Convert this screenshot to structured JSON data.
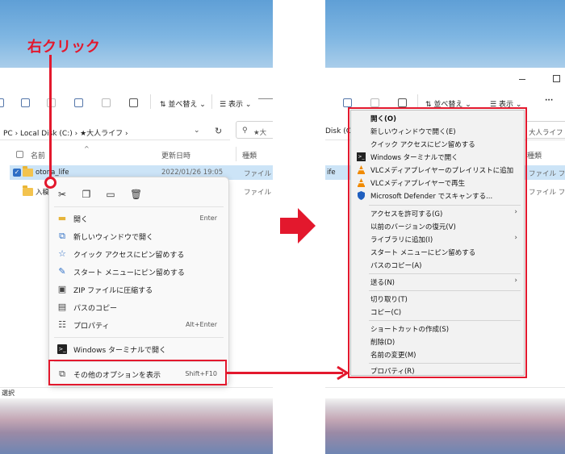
{
  "annotation": {
    "label": "右クリック"
  },
  "toolbar": {
    "sort_label": "並べ替え",
    "view_label": "表示",
    "more_label": "···"
  },
  "address": {
    "left_path": "PC  ›  Local Disk (C:)  ›  ★大人ライフ  ›",
    "right_path": "Disk (C:)",
    "search_placeholder": "★大",
    "search_placeholder_right": "大人ライフ"
  },
  "columns": {
    "name": "名前",
    "date": "更新日時",
    "type": "種類"
  },
  "files": [
    {
      "name": "otona_life",
      "date": "2022/01/26 19:05",
      "type": "ファイル フォル",
      "type_right": "ファイル フォルダー",
      "right_name": "ife"
    },
    {
      "name": "入稿",
      "date": "",
      "type": "ファイル フォル",
      "type_right": "ファイル フォルダー",
      "right_name": ""
    }
  ],
  "status_bar": {
    "left": "選択"
  },
  "context_menu_modern": {
    "items": [
      {
        "label": "開く",
        "shortcut": "Enter",
        "icon": "folder-open-icon"
      },
      {
        "label": "新しいウィンドウで開く",
        "shortcut": "",
        "icon": "external-window-icon"
      },
      {
        "label": "クイック アクセスにピン留めする",
        "shortcut": "",
        "icon": "star-icon"
      },
      {
        "label": "スタート メニューにピン留めする",
        "shortcut": "",
        "icon": "pin-icon"
      },
      {
        "label": "ZIP ファイルに圧縮する",
        "shortcut": "",
        "icon": "zip-icon"
      },
      {
        "label": "パスのコピー",
        "shortcut": "",
        "icon": "copy-path-icon"
      },
      {
        "label": "プロパティ",
        "shortcut": "Alt+Enter",
        "icon": "properties-icon"
      },
      {
        "label": "Windows ターミナルで開く",
        "shortcut": "",
        "icon": "terminal-icon"
      },
      {
        "label": "その他のオプションを表示",
        "shortcut": "Shift+F10",
        "icon": "more-options-icon"
      }
    ]
  },
  "context_menu_classic": {
    "items": [
      {
        "label": "開く(O)",
        "bold": true,
        "icon": "",
        "arrow": false
      },
      {
        "label": "新しいウィンドウで開く(E)",
        "bold": false,
        "icon": "",
        "arrow": false
      },
      {
        "label": "クイック アクセスにピン留めする",
        "bold": false,
        "icon": "",
        "arrow": false
      },
      {
        "label": "Windows ターミナルで開く",
        "bold": false,
        "icon": "terminal-icon",
        "arrow": false
      },
      {
        "label": "VLCメディアプレイヤーのプレイリストに追加",
        "bold": false,
        "icon": "vlc-icon",
        "arrow": false
      },
      {
        "label": "VLCメディアプレイヤーで再生",
        "bold": false,
        "icon": "vlc-icon",
        "arrow": false
      },
      {
        "label": "Microsoft Defender でスキャンする...",
        "bold": false,
        "icon": "defender-shield-icon",
        "arrow": false
      },
      {
        "label": "アクセスを許可する(G)",
        "bold": false,
        "icon": "",
        "arrow": true
      },
      {
        "label": "以前のバージョンの復元(V)",
        "bold": false,
        "icon": "",
        "arrow": false
      },
      {
        "label": "ライブラリに追加(I)",
        "bold": false,
        "icon": "",
        "arrow": true
      },
      {
        "label": "スタート メニューにピン留めする",
        "bold": false,
        "icon": "",
        "arrow": false
      },
      {
        "label": "パスのコピー(A)",
        "bold": false,
        "icon": "",
        "arrow": false
      },
      {
        "label": "送る(N)",
        "bold": false,
        "icon": "",
        "arrow": true
      },
      {
        "label": "切り取り(T)",
        "bold": false,
        "icon": "",
        "arrow": false
      },
      {
        "label": "コピー(C)",
        "bold": false,
        "icon": "",
        "arrow": false
      },
      {
        "label": "ショートカットの作成(S)",
        "bold": false,
        "icon": "",
        "arrow": false
      },
      {
        "label": "削除(D)",
        "bold": false,
        "icon": "",
        "arrow": false
      },
      {
        "label": "名前の変更(M)",
        "bold": false,
        "icon": "",
        "arrow": false
      },
      {
        "label": "プロパティ(R)",
        "bold": false,
        "icon": "",
        "arrow": false
      }
    ]
  },
  "colors": {
    "accent_red": "#e3182d",
    "selection": "#cce4f7"
  }
}
